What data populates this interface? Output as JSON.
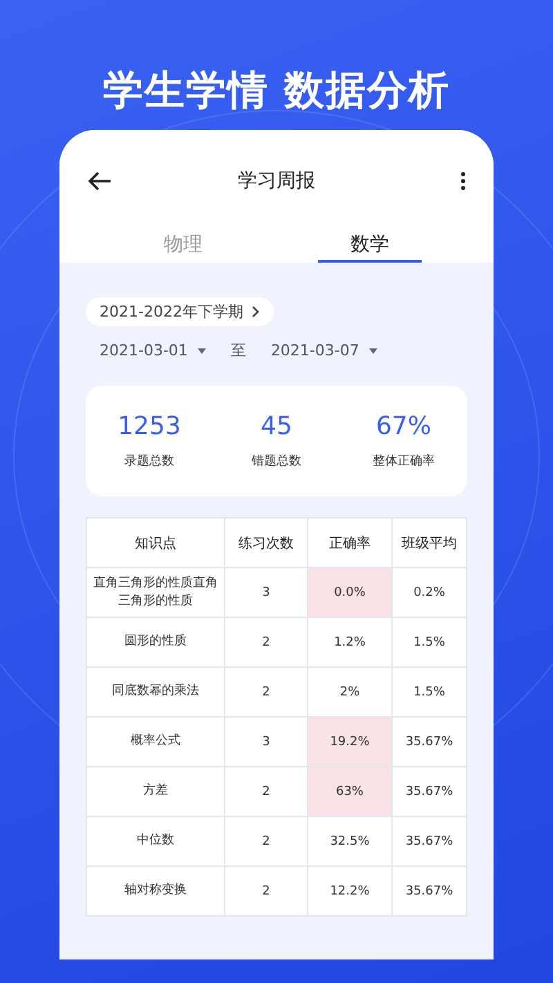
{
  "headline": "学生学情 数据分析",
  "app": {
    "title": "学习周报"
  },
  "tabs": [
    {
      "label": "物理",
      "selected": false
    },
    {
      "label": "数学",
      "selected": true
    }
  ],
  "term": "2021-2022年下学期",
  "date_from": "2021-03-01",
  "date_sep": "至",
  "date_to": "2021-03-07",
  "stats": [
    {
      "value": "1253",
      "label": "录题总数"
    },
    {
      "value": "45",
      "label": "错题总数"
    },
    {
      "value": "67%",
      "label": "整体正确率"
    }
  ],
  "table": {
    "columns": [
      "知识点",
      "练习次数",
      "正确率",
      "班级平均"
    ],
    "rows": [
      {
        "topic": "直角三角形的性质直角三角形的性质",
        "count": "3",
        "rate": "0.0%",
        "avg": "0.2%",
        "flagged": true
      },
      {
        "topic": "圆形的性质",
        "count": "2",
        "rate": "1.2%",
        "avg": "1.5%",
        "flagged": false
      },
      {
        "topic": "同底数幂的乘法",
        "count": "2",
        "rate": "2%",
        "avg": "1.5%",
        "flagged": false
      },
      {
        "topic": "概率公式",
        "count": "3",
        "rate": "19.2%",
        "avg": "35.67%",
        "flagged": true
      },
      {
        "topic": "方差",
        "count": "2",
        "rate": "63%",
        "avg": "35.67%",
        "flagged": true
      },
      {
        "topic": "中位数",
        "count": "2",
        "rate": "32.5%",
        "avg": "35.67%",
        "flagged": false
      },
      {
        "topic": "轴对称变换",
        "count": "2",
        "rate": "12.2%",
        "avg": "35.67%",
        "flagged": false
      }
    ]
  }
}
